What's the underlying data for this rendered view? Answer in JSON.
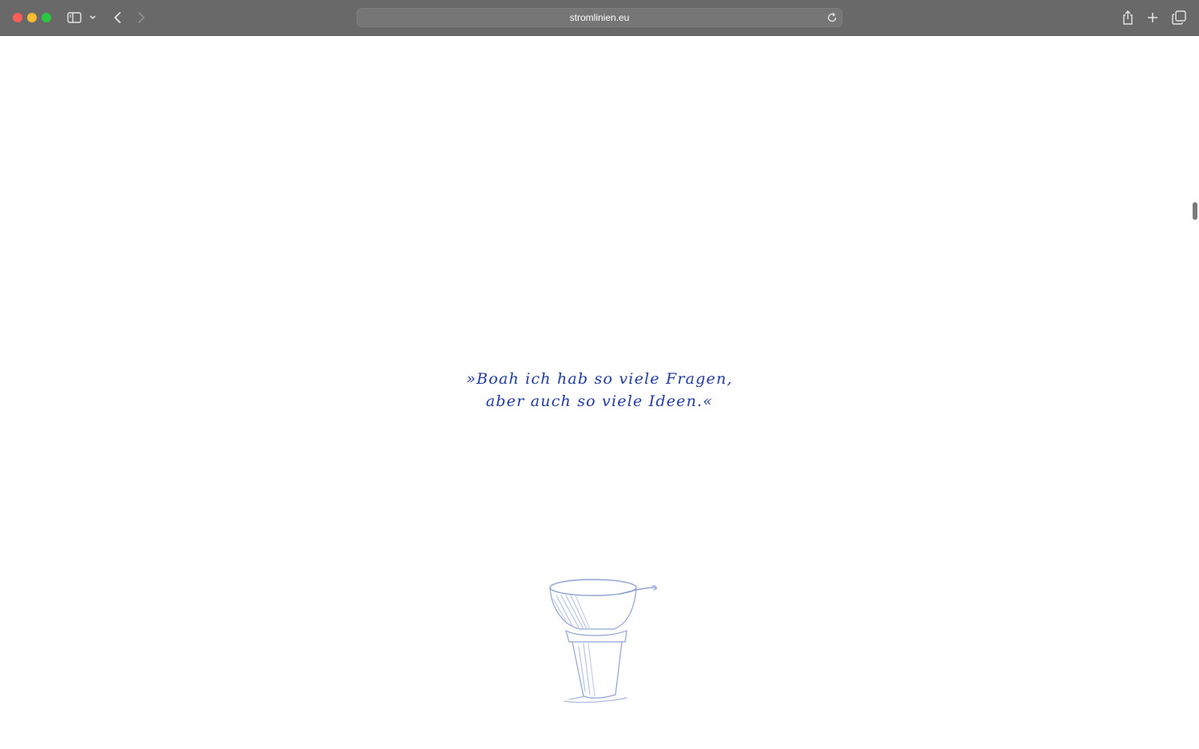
{
  "browser": {
    "url": "stromlinien.eu"
  },
  "page": {
    "quote_line1": "»Boah ich hab so viele Fragen,",
    "quote_line2": "aber auch so viele Ideen.«"
  },
  "colors": {
    "quote": "#1f3aa3",
    "toolbar": "#696969"
  },
  "icons": [
    "sidebar-icon",
    "chevron-down-icon",
    "back-icon",
    "forward-icon",
    "reload-icon",
    "share-icon",
    "new-tab-icon",
    "tabs-overview-icon"
  ]
}
